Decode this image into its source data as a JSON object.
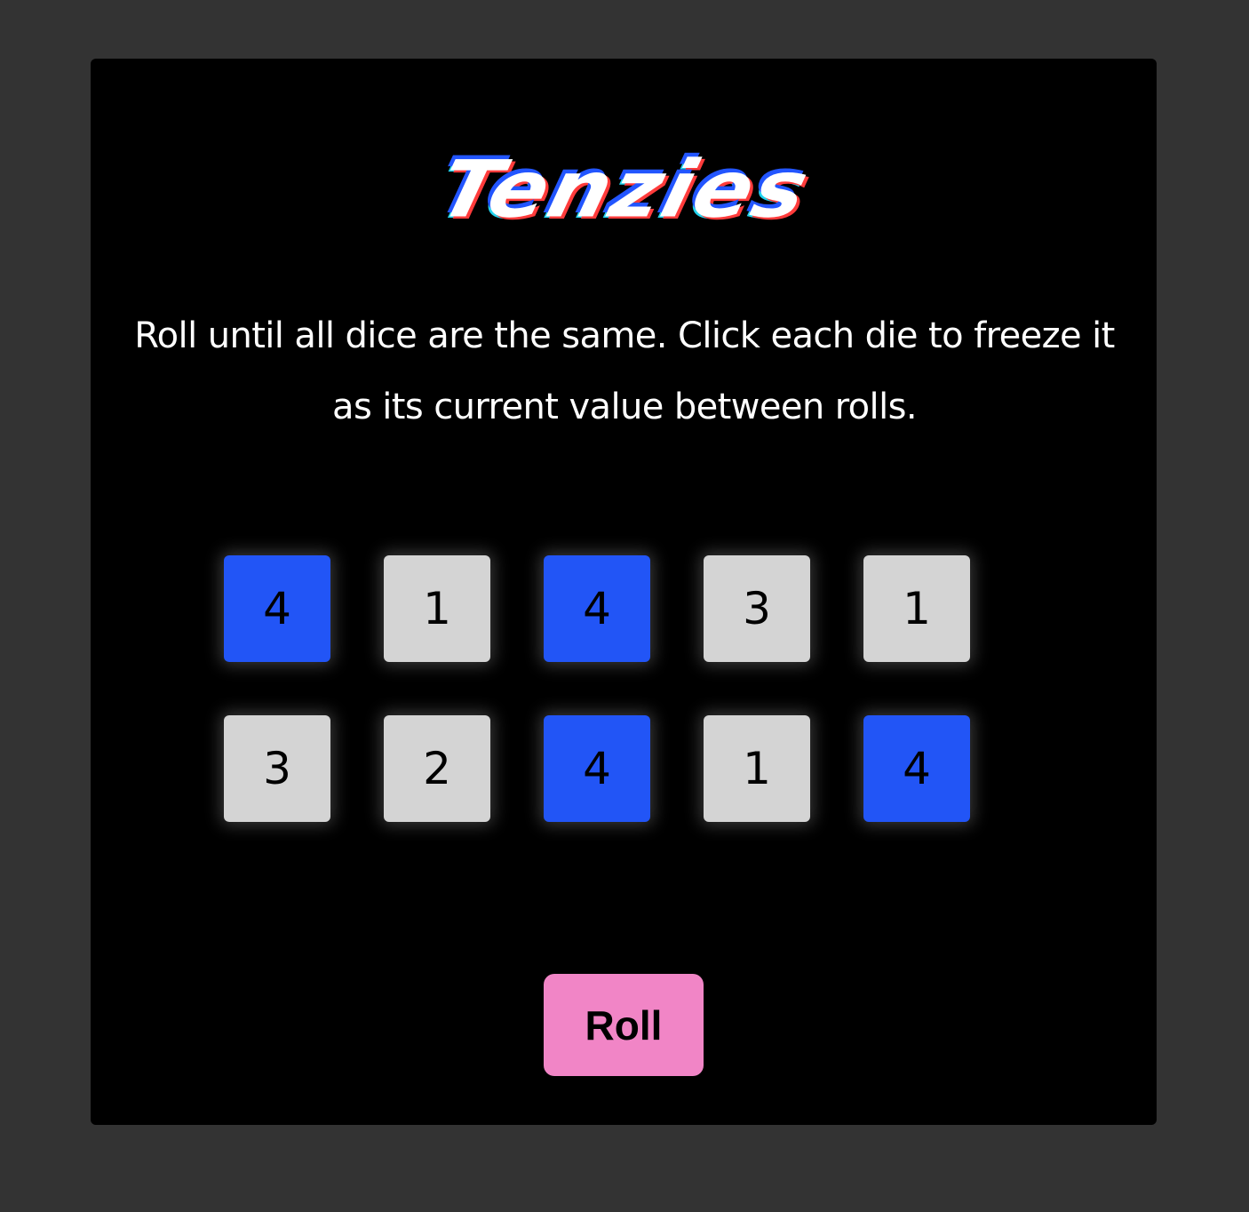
{
  "app": {
    "title": "Tenzies",
    "instructions": "Roll until all dice are the same. Click each die to freeze it as its current value between rolls."
  },
  "dice": [
    {
      "value": "4",
      "held": true
    },
    {
      "value": "1",
      "held": false
    },
    {
      "value": "4",
      "held": true
    },
    {
      "value": "3",
      "held": false
    },
    {
      "value": "1",
      "held": false
    },
    {
      "value": "3",
      "held": false
    },
    {
      "value": "2",
      "held": false
    },
    {
      "value": "4",
      "held": true
    },
    {
      "value": "1",
      "held": false
    },
    {
      "value": "4",
      "held": true
    }
  ],
  "controls": {
    "roll_label": "Roll"
  },
  "colors": {
    "page_background": "#333333",
    "board_background": "#000000",
    "die_held": "#2255f6",
    "die_free": "#d4d4d4",
    "roll_button": "#f185c6"
  }
}
